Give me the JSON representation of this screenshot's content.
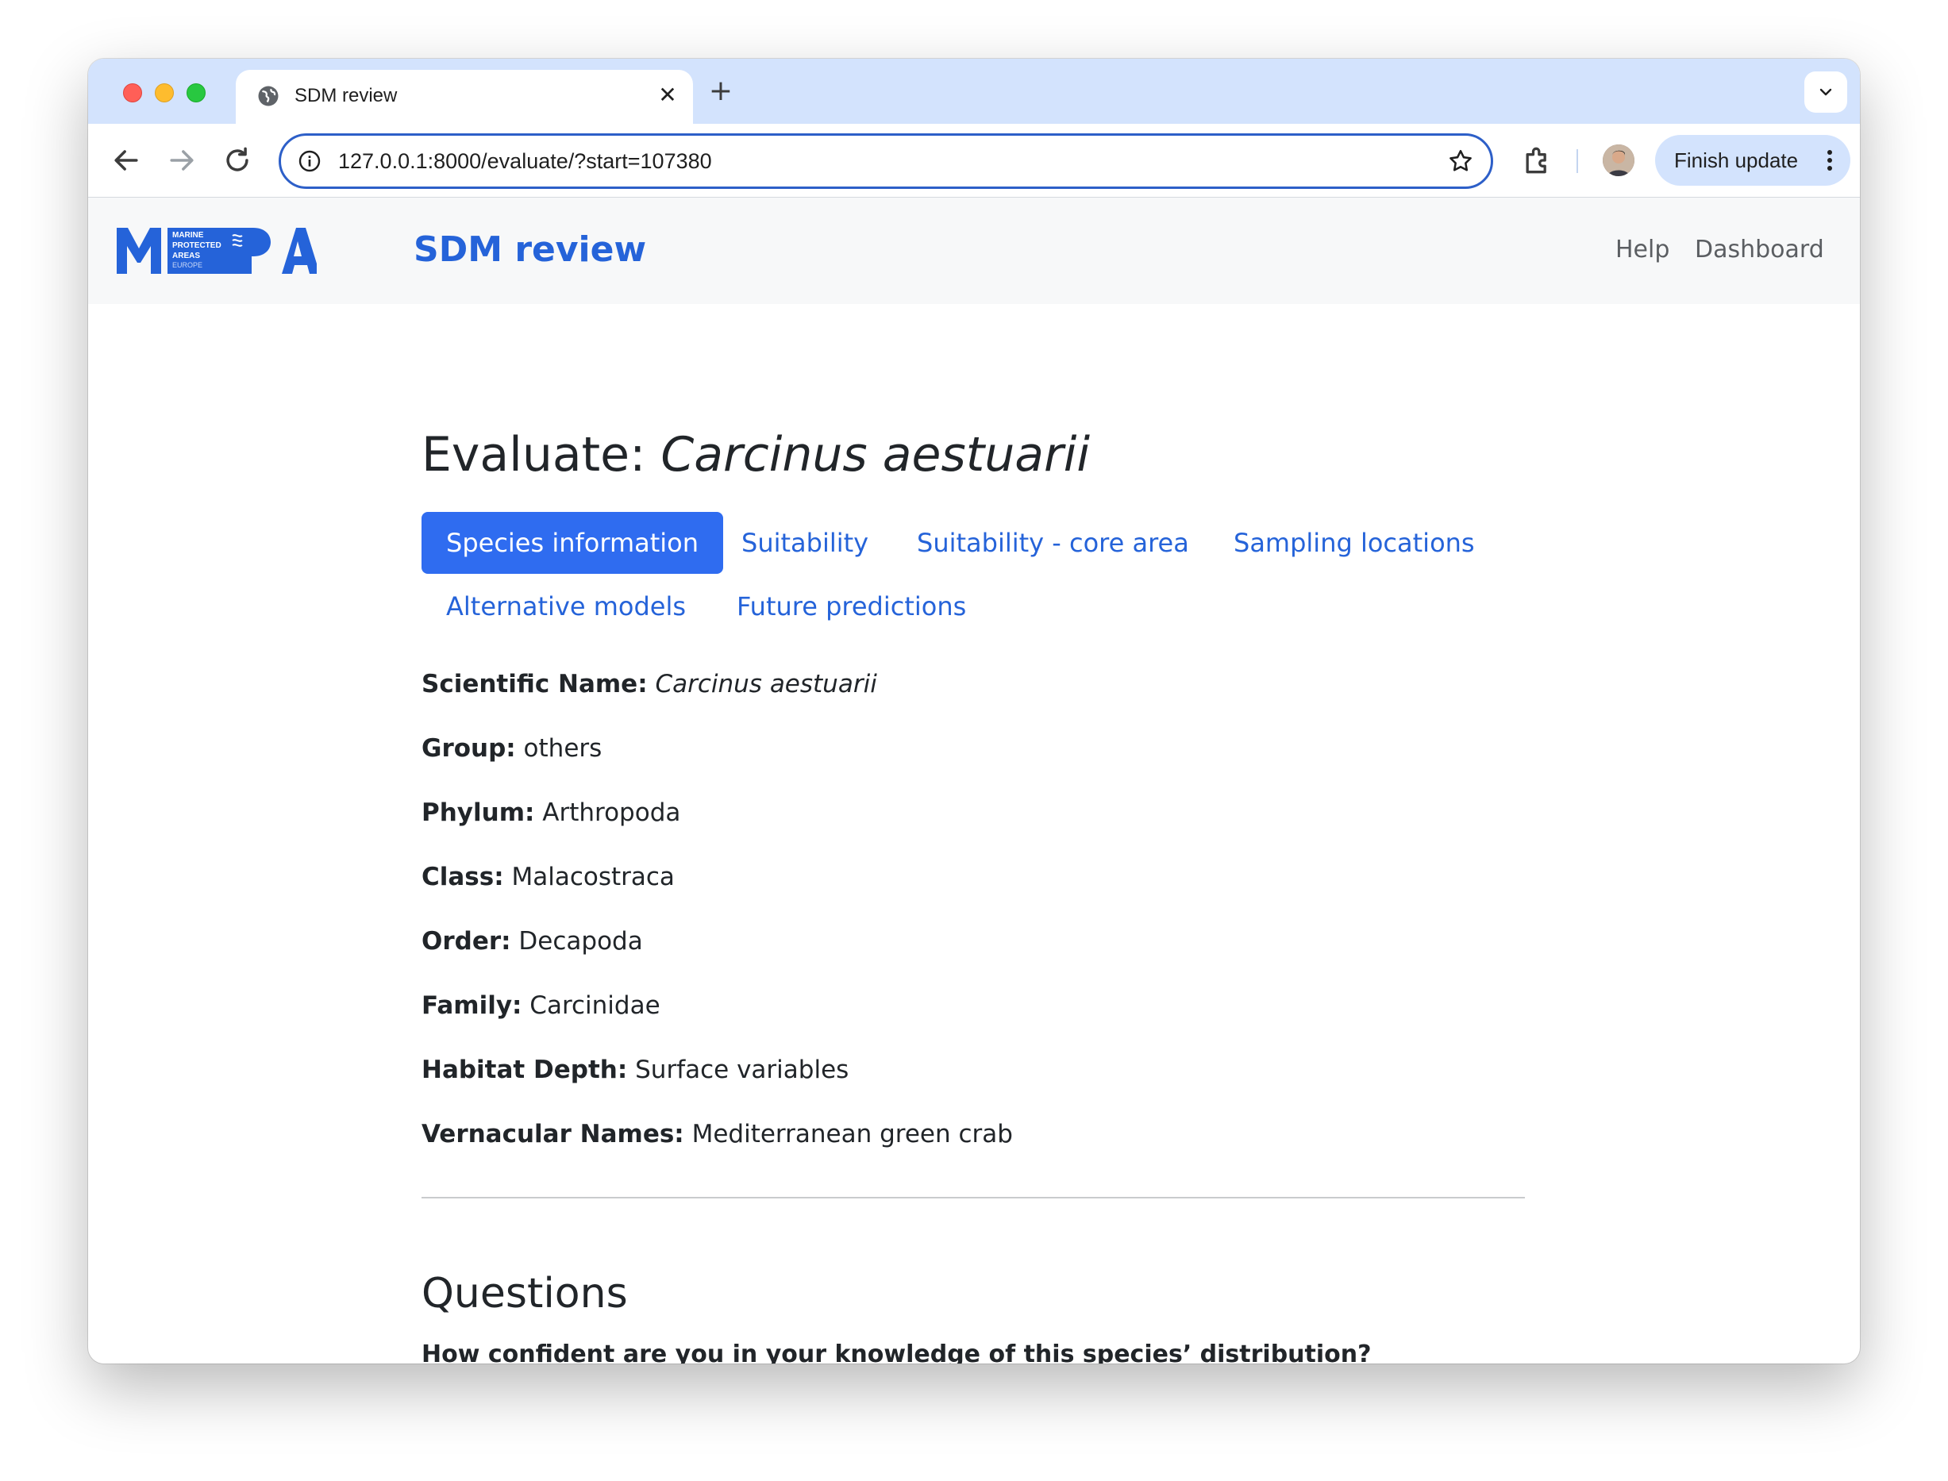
{
  "browser": {
    "tab_title": "SDM review",
    "url": "127.0.0.1:8000/evaluate/?start=107380",
    "finish_update_label": "Finish update"
  },
  "site": {
    "logo_text": "MPA",
    "logo_sub": [
      "MARINE",
      "PROTECTED",
      "AREAS",
      "EUROPE"
    ],
    "brand": "SDM review",
    "nav": {
      "help": "Help",
      "dashboard": "Dashboard"
    },
    "colors": {
      "brand_blue": "#2563d9",
      "active_tab": "#2f6cf0"
    }
  },
  "page": {
    "heading_prefix": "Evaluate: ",
    "heading_species": "Carcinus aestuarii",
    "tabs": [
      {
        "label": "Species information",
        "active": true
      },
      {
        "label": "Suitability",
        "active": false
      },
      {
        "label": "Suitability - core area",
        "active": false
      },
      {
        "label": "Sampling locations",
        "active": false
      },
      {
        "label": "Alternative models",
        "active": false
      },
      {
        "label": "Future predictions",
        "active": false
      }
    ],
    "species_info": {
      "scientific_name_label": "Scientific Name:",
      "scientific_name": "Carcinus aestuarii",
      "group_label": "Group:",
      "group": "others",
      "phylum_label": "Phylum:",
      "phylum": "Arthropoda",
      "class_label": "Class:",
      "class": "Malacostraca",
      "order_label": "Order:",
      "order": "Decapoda",
      "family_label": "Family:",
      "family": "Carcinidae",
      "habitat_depth_label": "Habitat Depth:",
      "habitat_depth": "Surface variables",
      "vernacular_label": "Vernacular Names:",
      "vernacular": "Mediterranean green crab"
    },
    "questions": {
      "heading": "Questions",
      "q1": "How confident are you in your knowledge of this species’ distribution?"
    }
  }
}
